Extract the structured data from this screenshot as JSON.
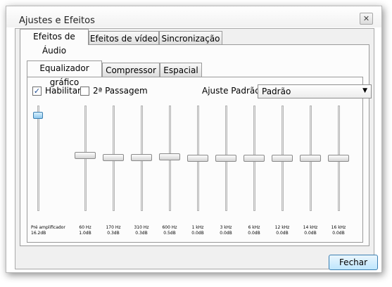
{
  "window": {
    "title": "Ajustes e Efeitos",
    "close_glyph": "✕"
  },
  "tabs": [
    {
      "label": "Efeitos de Áudio",
      "active": true
    },
    {
      "label": "Efeitos de vídeo",
      "active": false
    },
    {
      "label": "Sincronização",
      "active": false
    }
  ],
  "subtabs": [
    {
      "label": "Equalizador gráfico",
      "active": true
    },
    {
      "label": "Compressor",
      "active": false
    },
    {
      "label": "Espacial",
      "active": false
    }
  ],
  "controls": {
    "enable_label": "Habilitar",
    "enable_checked": true,
    "check_glyph": "✓",
    "second_pass_label": "2ª Passagem",
    "second_pass_checked": false,
    "preset_label": "Ajuste Padrão",
    "preset_value": "Padrão",
    "dropdown_icon": "▼"
  },
  "equalizer": {
    "range_db": [
      -20,
      20
    ],
    "preamp": {
      "label": "Pré amplificador",
      "value": "16.2dB",
      "db": 16.2
    },
    "bands": [
      {
        "freq": "60 Hz",
        "value": "1.0dB",
        "db": 1.0
      },
      {
        "freq": "170 Hz",
        "value": "0.3dB",
        "db": 0.3
      },
      {
        "freq": "310 Hz",
        "value": "0.3dB",
        "db": 0.3
      },
      {
        "freq": "600 Hz",
        "value": "0.5dB",
        "db": 0.5
      },
      {
        "freq": "1 kHz",
        "value": "0.0dB",
        "db": 0.0
      },
      {
        "freq": "3 kHz",
        "value": "0.0dB",
        "db": 0.0
      },
      {
        "freq": "6 kHz",
        "value": "0.0dB",
        "db": 0.0
      },
      {
        "freq": "12 kHz",
        "value": "0.0dB",
        "db": 0.0
      },
      {
        "freq": "14 kHz",
        "value": "0.0dB",
        "db": 0.0
      },
      {
        "freq": "16 kHz",
        "value": "0.0dB",
        "db": 0.0
      }
    ]
  },
  "footer": {
    "close_label": "Fechar"
  }
}
